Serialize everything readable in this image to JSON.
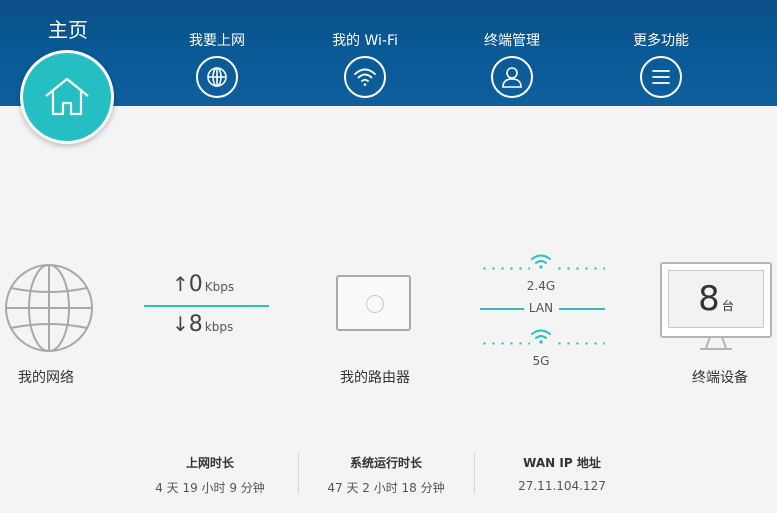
{
  "header": {
    "home_label": "主页",
    "nav": [
      {
        "label": "我要上网",
        "icon": "globe-icon"
      },
      {
        "label": "我的 Wi-Fi",
        "icon": "wifi-icon"
      },
      {
        "label": "终端管理",
        "icon": "user-icon"
      },
      {
        "label": "更多功能",
        "icon": "menu-icon"
      }
    ]
  },
  "topology": {
    "network_label": "我的网络",
    "upload": {
      "value": "0",
      "unit": "Kbps"
    },
    "download": {
      "value": "8",
      "unit": "kbps"
    },
    "router_label": "我的路由器",
    "band_24": "2.4G",
    "lan": "LAN",
    "band_5": "5G",
    "devices": {
      "count": "8",
      "unit": "台",
      "label": "终端设备"
    }
  },
  "stats": [
    {
      "title": "上网时长",
      "value": "4 天 19 小时 9 分钟"
    },
    {
      "title": "系统运行时长",
      "value": "47 天 2 小时 18 分钟"
    },
    {
      "title": "WAN IP 地址",
      "value": "27.11.104.127"
    }
  ],
  "colors": {
    "header": "#0b4f86",
    "accent": "#25bfc3"
  }
}
